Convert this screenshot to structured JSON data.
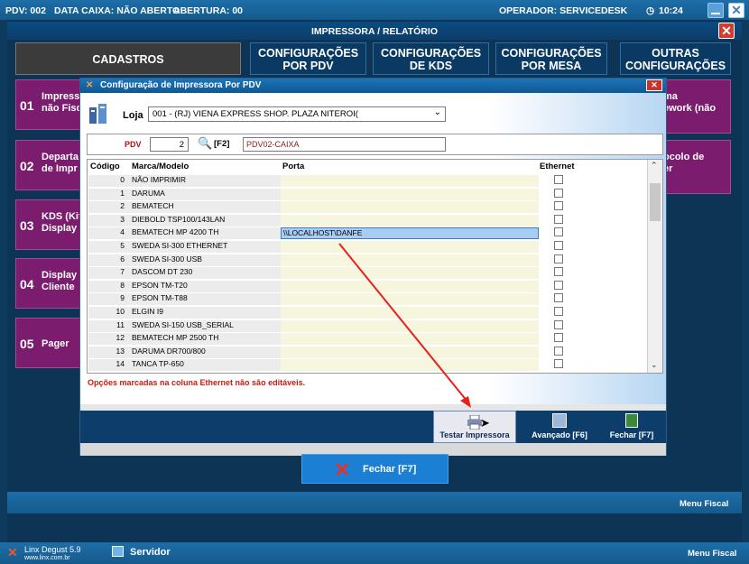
{
  "topbar": {
    "pdv": "PDV: 002",
    "data_caixa": "DATA CAIXA: NÃO ABERTO",
    "abertura": "ABERTURA: 00",
    "operador": "OPERADOR: SERVICEDESK",
    "time": "10:24"
  },
  "subtitle": "IMPRESSORA / RELATÓRIO",
  "tabs": {
    "cadastros": "CADASTROS",
    "pdv_line1": "CONFIGURAÇÕES",
    "pdv_line2": "POR PDV",
    "kds_line1": "CONFIGURAÇÕES",
    "kds_line2": "DE KDS",
    "mesa_line1": "CONFIGURAÇÕES",
    "mesa_line2": "POR MESA",
    "outras_line1": "OUTRAS",
    "outras_line2": "CONFIGURAÇÕES"
  },
  "left_items": [
    {
      "num": "01",
      "line1": "Impress",
      "line2": "não Fisc"
    },
    {
      "num": "02",
      "line1": "Departa",
      "line2": "de Impr"
    },
    {
      "num": "03",
      "line1": "KDS (Kit",
      "line2": "Display"
    },
    {
      "num": "04",
      "line1": "Display",
      "line2": "Cliente"
    },
    {
      "num": "05",
      "line1": "Pager",
      "line2": ""
    }
  ],
  "right_items": [
    {
      "line1": "ma",
      "line2": "ework (não",
      "line3": ")"
    },
    {
      "line1": "ocolo de",
      "line2": "er",
      "line3": ""
    }
  ],
  "dialog": {
    "title": "Configuração de Impressora Por PDV",
    "loja_label": "Loja",
    "loja_value": "001 - (RJ) VIENA EXPRESS  SHOP. PLAZA NITEROI(",
    "pdv_label": "PDV",
    "pdv_value": "2",
    "f2_label": "[F2]",
    "pdv_name": "PDV02-CAIXA",
    "columns": {
      "codigo": "Código",
      "marca": "Marca/Modelo",
      "porta": "Porta",
      "ethernet": "Ethernet"
    },
    "rows": [
      {
        "code": "0",
        "model": "NÃO IMPRIMIR",
        "porta": ""
      },
      {
        "code": "1",
        "model": "DARUMA",
        "porta": ""
      },
      {
        "code": "2",
        "model": "BEMATECH",
        "porta": ""
      },
      {
        "code": "3",
        "model": "DIEBOLD TSP100/143LAN",
        "porta": ""
      },
      {
        "code": "4",
        "model": "BEMATECH MP 4200 TH",
        "porta": "\\\\LOCALHOST\\DANFE"
      },
      {
        "code": "5",
        "model": "SWEDA SI-300 ETHERNET",
        "porta": ""
      },
      {
        "code": "6",
        "model": "SWEDA SI-300 USB",
        "porta": ""
      },
      {
        "code": "7",
        "model": "DASCOM DT 230",
        "porta": ""
      },
      {
        "code": "8",
        "model": "EPSON TM-T20",
        "porta": ""
      },
      {
        "code": "9",
        "model": "EPSON TM-T88",
        "porta": ""
      },
      {
        "code": "10",
        "model": "ELGIN I9",
        "porta": ""
      },
      {
        "code": "11",
        "model": "SWEDA SI-150 USB_SERIAL",
        "porta": ""
      },
      {
        "code": "12",
        "model": "BEMATECH MP 2500 TH",
        "porta": ""
      },
      {
        "code": "13",
        "model": "DARUMA DR700/800",
        "porta": ""
      },
      {
        "code": "14",
        "model": "TANCA TP-650",
        "porta": ""
      }
    ],
    "warning": "Opções marcadas na coluna Ethernet não são editáveis.",
    "btn_testar": "Testar Impressora",
    "btn_avancado": "Avançado [F6]",
    "btn_fechar": "Fechar [F7]"
  },
  "fechar_main": "Fechar [F7]",
  "menu_fiscal_top": "Menu Fiscal",
  "bottombar": {
    "app": "Linx Degust 5.9",
    "site": "www.linx.com.br",
    "servidor": "Servidor",
    "menu_fiscal": "Menu Fiscal"
  },
  "colors": {
    "accent": "#7b1c6e",
    "warning": "#cc1a12",
    "arrow": "#e8201a"
  }
}
